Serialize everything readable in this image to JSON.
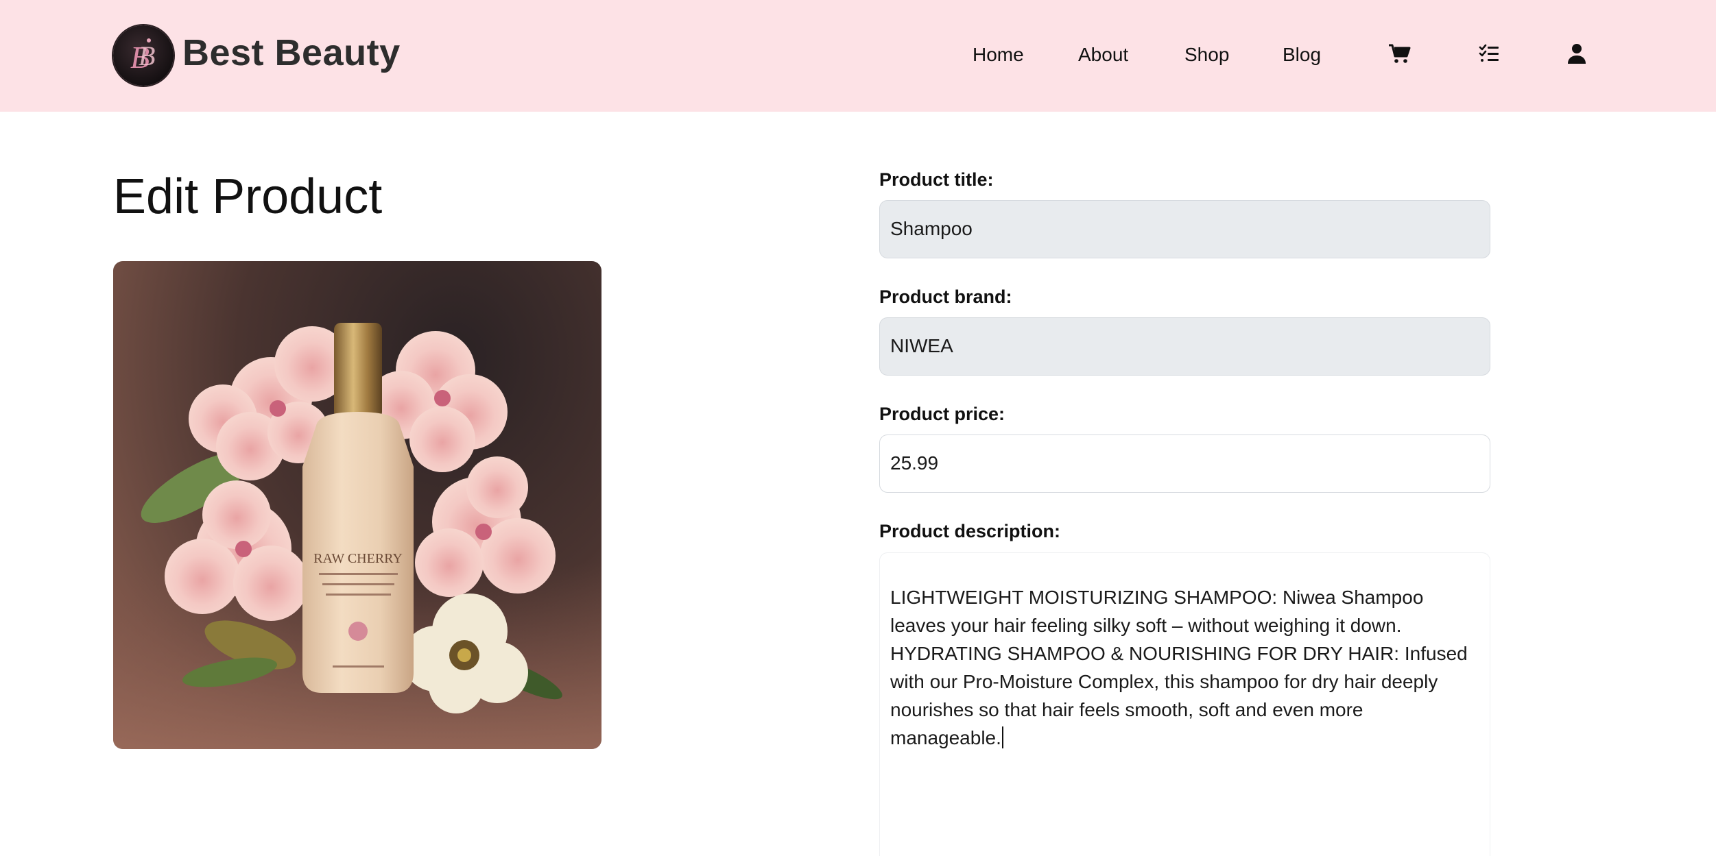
{
  "header": {
    "brand_name": "Best Beauty",
    "background_color": "#fde2e6",
    "logo_icon": "bb-monogram-logo",
    "nav": [
      {
        "label": "Home"
      },
      {
        "label": "About"
      },
      {
        "label": "Shop"
      },
      {
        "label": "Blog"
      }
    ],
    "icons": [
      {
        "name": "cart-icon"
      },
      {
        "name": "checklist-icon"
      },
      {
        "name": "user-icon"
      }
    ]
  },
  "main": {
    "page_title": "Edit Product",
    "product_image_alt": "product-photo",
    "form": {
      "title": {
        "label": "Product title:",
        "value": "Shampoo",
        "disabled": true
      },
      "brand": {
        "label": "Product brand:",
        "value": "NIWEA",
        "disabled": true
      },
      "price": {
        "label": "Product price:",
        "value": "25.99",
        "disabled": false
      },
      "description": {
        "label": "Product description:",
        "value": "LIGHTWEIGHT MOISTURIZING SHAMPOO: Niwea Shampoo leaves your hair feeling silky soft – without weighing it down. HYDRATING SHAMPOO & NOURISHING FOR DRY HAIR: Infused with our Pro-Moisture Complex, this shampoo for dry hair deeply nourishes so that hair feels smooth, soft and even more manageable."
      }
    }
  }
}
